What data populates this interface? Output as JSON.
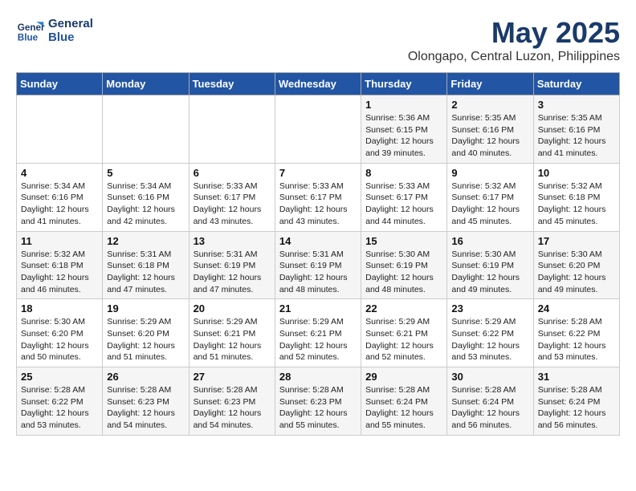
{
  "logo": {
    "line1": "General",
    "line2": "Blue"
  },
  "title": "May 2025",
  "subtitle": "Olongapo, Central Luzon, Philippines",
  "days_header": [
    "Sunday",
    "Monday",
    "Tuesday",
    "Wednesday",
    "Thursday",
    "Friday",
    "Saturday"
  ],
  "weeks": [
    [
      {
        "num": "",
        "info": ""
      },
      {
        "num": "",
        "info": ""
      },
      {
        "num": "",
        "info": ""
      },
      {
        "num": "",
        "info": ""
      },
      {
        "num": "1",
        "info": "Sunrise: 5:36 AM\nSunset: 6:15 PM\nDaylight: 12 hours\nand 39 minutes."
      },
      {
        "num": "2",
        "info": "Sunrise: 5:35 AM\nSunset: 6:16 PM\nDaylight: 12 hours\nand 40 minutes."
      },
      {
        "num": "3",
        "info": "Sunrise: 5:35 AM\nSunset: 6:16 PM\nDaylight: 12 hours\nand 41 minutes."
      }
    ],
    [
      {
        "num": "4",
        "info": "Sunrise: 5:34 AM\nSunset: 6:16 PM\nDaylight: 12 hours\nand 41 minutes."
      },
      {
        "num": "5",
        "info": "Sunrise: 5:34 AM\nSunset: 6:16 PM\nDaylight: 12 hours\nand 42 minutes."
      },
      {
        "num": "6",
        "info": "Sunrise: 5:33 AM\nSunset: 6:17 PM\nDaylight: 12 hours\nand 43 minutes."
      },
      {
        "num": "7",
        "info": "Sunrise: 5:33 AM\nSunset: 6:17 PM\nDaylight: 12 hours\nand 43 minutes."
      },
      {
        "num": "8",
        "info": "Sunrise: 5:33 AM\nSunset: 6:17 PM\nDaylight: 12 hours\nand 44 minutes."
      },
      {
        "num": "9",
        "info": "Sunrise: 5:32 AM\nSunset: 6:17 PM\nDaylight: 12 hours\nand 45 minutes."
      },
      {
        "num": "10",
        "info": "Sunrise: 5:32 AM\nSunset: 6:18 PM\nDaylight: 12 hours\nand 45 minutes."
      }
    ],
    [
      {
        "num": "11",
        "info": "Sunrise: 5:32 AM\nSunset: 6:18 PM\nDaylight: 12 hours\nand 46 minutes."
      },
      {
        "num": "12",
        "info": "Sunrise: 5:31 AM\nSunset: 6:18 PM\nDaylight: 12 hours\nand 47 minutes."
      },
      {
        "num": "13",
        "info": "Sunrise: 5:31 AM\nSunset: 6:19 PM\nDaylight: 12 hours\nand 47 minutes."
      },
      {
        "num": "14",
        "info": "Sunrise: 5:31 AM\nSunset: 6:19 PM\nDaylight: 12 hours\nand 48 minutes."
      },
      {
        "num": "15",
        "info": "Sunrise: 5:30 AM\nSunset: 6:19 PM\nDaylight: 12 hours\nand 48 minutes."
      },
      {
        "num": "16",
        "info": "Sunrise: 5:30 AM\nSunset: 6:19 PM\nDaylight: 12 hours\nand 49 minutes."
      },
      {
        "num": "17",
        "info": "Sunrise: 5:30 AM\nSunset: 6:20 PM\nDaylight: 12 hours\nand 49 minutes."
      }
    ],
    [
      {
        "num": "18",
        "info": "Sunrise: 5:30 AM\nSunset: 6:20 PM\nDaylight: 12 hours\nand 50 minutes."
      },
      {
        "num": "19",
        "info": "Sunrise: 5:29 AM\nSunset: 6:20 PM\nDaylight: 12 hours\nand 51 minutes."
      },
      {
        "num": "20",
        "info": "Sunrise: 5:29 AM\nSunset: 6:21 PM\nDaylight: 12 hours\nand 51 minutes."
      },
      {
        "num": "21",
        "info": "Sunrise: 5:29 AM\nSunset: 6:21 PM\nDaylight: 12 hours\nand 52 minutes."
      },
      {
        "num": "22",
        "info": "Sunrise: 5:29 AM\nSunset: 6:21 PM\nDaylight: 12 hours\nand 52 minutes."
      },
      {
        "num": "23",
        "info": "Sunrise: 5:29 AM\nSunset: 6:22 PM\nDaylight: 12 hours\nand 53 minutes."
      },
      {
        "num": "24",
        "info": "Sunrise: 5:28 AM\nSunset: 6:22 PM\nDaylight: 12 hours\nand 53 minutes."
      }
    ],
    [
      {
        "num": "25",
        "info": "Sunrise: 5:28 AM\nSunset: 6:22 PM\nDaylight: 12 hours\nand 53 minutes."
      },
      {
        "num": "26",
        "info": "Sunrise: 5:28 AM\nSunset: 6:23 PM\nDaylight: 12 hours\nand 54 minutes."
      },
      {
        "num": "27",
        "info": "Sunrise: 5:28 AM\nSunset: 6:23 PM\nDaylight: 12 hours\nand 54 minutes."
      },
      {
        "num": "28",
        "info": "Sunrise: 5:28 AM\nSunset: 6:23 PM\nDaylight: 12 hours\nand 55 minutes."
      },
      {
        "num": "29",
        "info": "Sunrise: 5:28 AM\nSunset: 6:24 PM\nDaylight: 12 hours\nand 55 minutes."
      },
      {
        "num": "30",
        "info": "Sunrise: 5:28 AM\nSunset: 6:24 PM\nDaylight: 12 hours\nand 56 minutes."
      },
      {
        "num": "31",
        "info": "Sunrise: 5:28 AM\nSunset: 6:24 PM\nDaylight: 12 hours\nand 56 minutes."
      }
    ]
  ]
}
